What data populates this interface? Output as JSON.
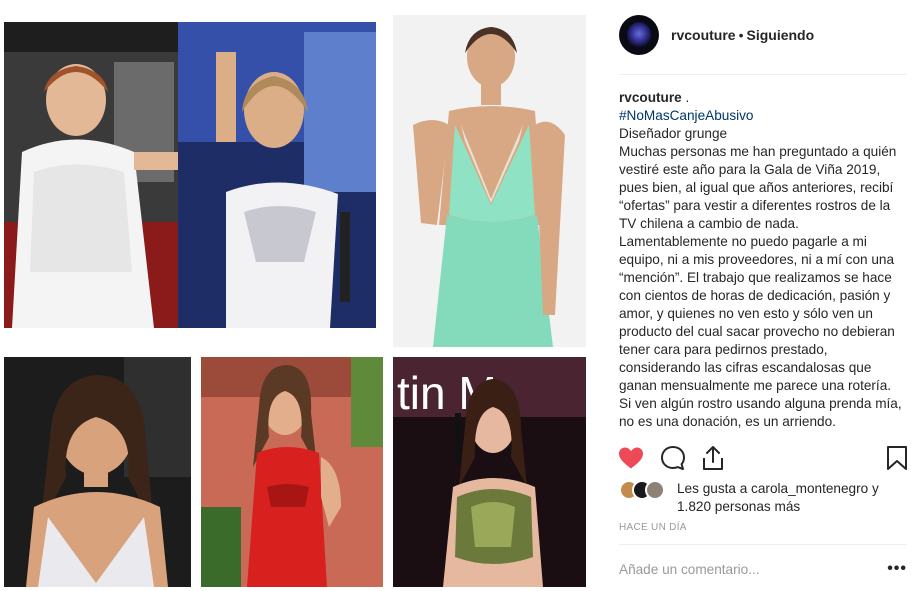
{
  "post": {
    "images": [
      {
        "name": "photo-woman-white-dress-pair"
      },
      {
        "name": "photo-woman-mint-dress"
      },
      {
        "name": "photo-woman-white-beaded-dress"
      },
      {
        "name": "photo-woman-red-dress"
      },
      {
        "name": "photo-woman-gold-bustier",
        "overlay_text": "tin M"
      }
    ]
  },
  "header": {
    "username": "rvcouture",
    "separator": "•",
    "follow_status": "Siguiendo"
  },
  "caption": {
    "username": "rvcouture",
    "username_suffix": " .",
    "hashtag": "#NoMasCanjeAbusivo",
    "lines": [
      "Diseñador grunge",
      "Muchas personas me han preguntado a quién vestiré este año para la Gala de Viña 2019, pues bien, al igual que años anteriores, recibí “ofertas” para vestir a diferentes rostros de la TV chilena a cambio de nada. Lamentablemente no puedo pagarle a mi equipo, ni a mis proveedores, ni a mí con una “mención”. El trabajo que realizamos se hace con cientos de horas de dedicación, pasión y amor, y quienes no ven esto y sólo ven un producto del cual sacar provecho no debieran tener cara para pedirnos prestado, considerando las cifras escandalosas que ganan mensualmente me parece una rotería.",
      "Si ven algún rostro usando alguna prenda mía, no es una donación, es un arriendo."
    ]
  },
  "actions": {
    "like_icon": "heart-icon",
    "comment_icon": "comment-bubble-icon",
    "share_icon": "share-icon",
    "save_icon": "bookmark-icon",
    "liked_color": "#ed4956"
  },
  "likes": {
    "text": "Les gusta a carola_montenegro y 1.820 personas más"
  },
  "timestamp": "HACE UN DÍA",
  "comment": {
    "placeholder": "Añade un comentario...",
    "more_label": "•••"
  },
  "colors": {
    "hashtag": "#003569",
    "muted": "#999999",
    "text": "#262626"
  }
}
